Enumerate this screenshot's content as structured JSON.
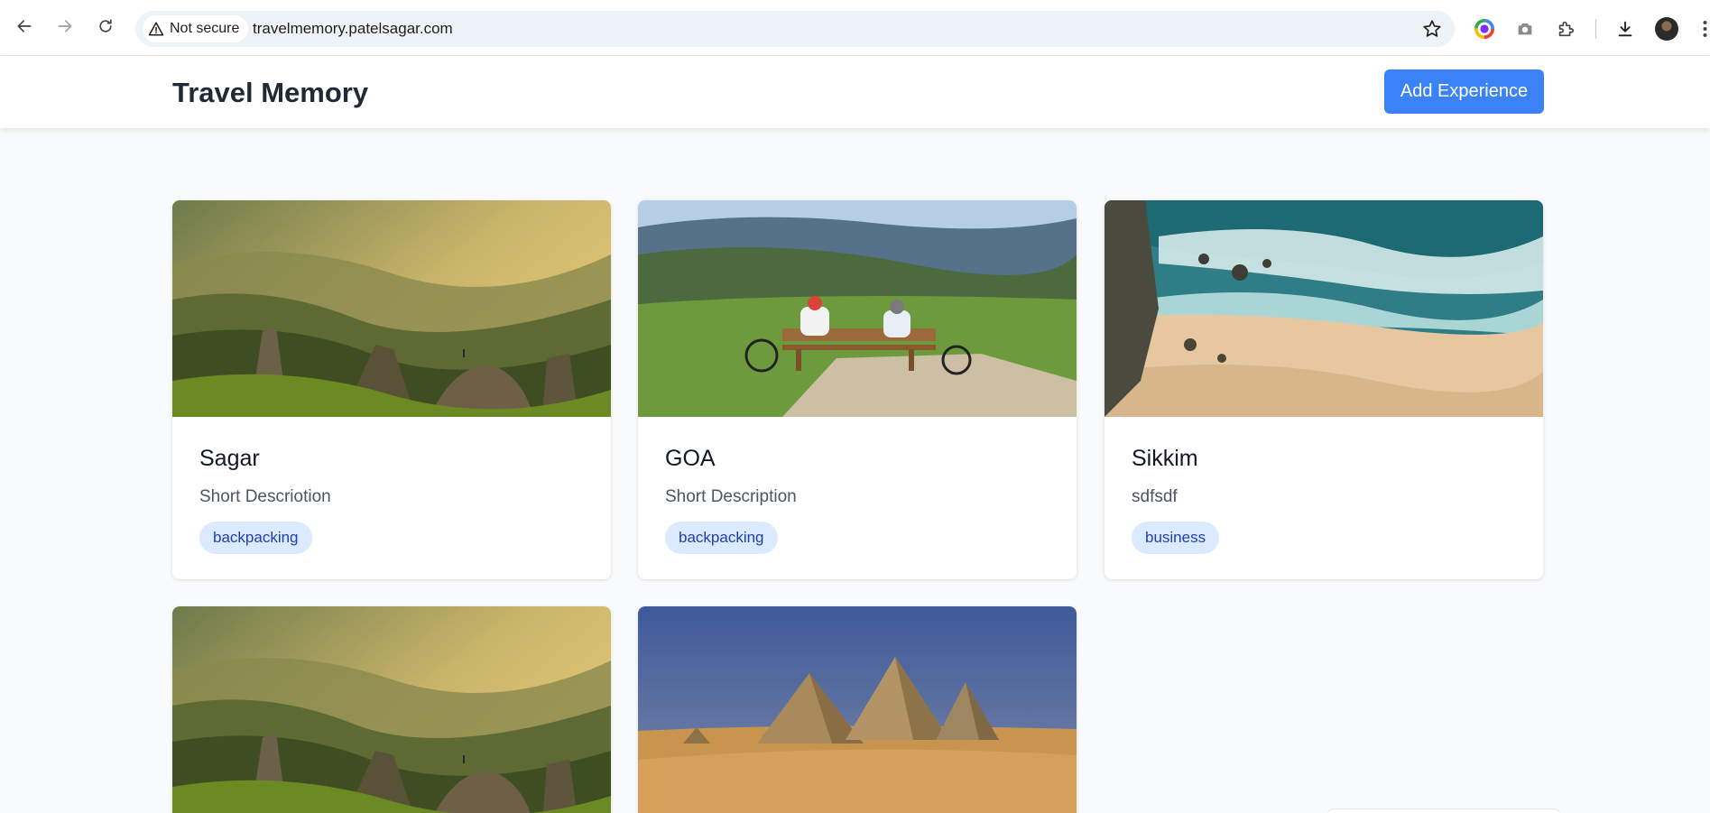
{
  "browser": {
    "security_label": "Not secure",
    "url": "travelmemory.patelsagar.com"
  },
  "app": {
    "title": "Travel Memory",
    "add_button_label": "Add Experience"
  },
  "cards": [
    {
      "title": "Sagar",
      "description": "Short Descriotion",
      "tag": "backpacking",
      "image": "mountain-valley-sunset"
    },
    {
      "title": "GOA",
      "description": "Short Description",
      "tag": "backpacking",
      "image": "cyclists-on-bench-hills"
    },
    {
      "title": "Sikkim",
      "description": "sdfsdf",
      "tag": "business",
      "image": "aerial-beach-waves"
    },
    {
      "title": "",
      "description": "",
      "tag": "",
      "image": "mountain-valley-sunset"
    },
    {
      "title": "",
      "description": "",
      "tag": "",
      "image": "pyramids-desert"
    }
  ],
  "colors": {
    "accent": "#3b82f6",
    "tag_bg": "#dbeafe",
    "tag_text": "#1e40af",
    "page_bg": "#f9fafb"
  }
}
